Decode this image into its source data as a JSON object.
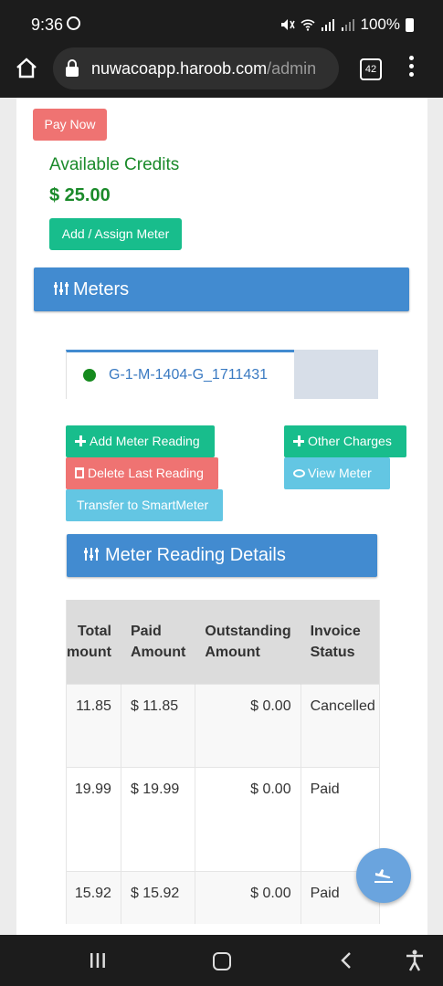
{
  "status_bar": {
    "time": "9:36",
    "battery": "100%"
  },
  "browser": {
    "url_host": "nuwacoapp.haroob.com",
    "url_path": "/admin",
    "tab_count": "42"
  },
  "account": {
    "pay_now_label": "Pay Now",
    "credits_label": "Available Credits",
    "credits_value": "$ 25.00",
    "assign_meter_label": "Add / Assign Meter"
  },
  "meters": {
    "heading": "Meters",
    "tabs": [
      {
        "name": "G-1-M-1404-G_1711431",
        "status_color": "#158a1e"
      }
    ]
  },
  "actions": {
    "add_reading": "Add Meter Reading",
    "other_charges": "Other Charges",
    "delete_last": "Delete Last Reading",
    "view_meter": "View Meter",
    "transfer": "Transfer to SmartMeter"
  },
  "details": {
    "heading": "Meter Reading Details",
    "columns": [
      [
        "Total",
        "Amount"
      ],
      [
        "Paid",
        "Amount"
      ],
      [
        "Outstanding",
        "Amount"
      ],
      [
        "Invoice",
        "Status"
      ]
    ],
    "rows": [
      {
        "total": "11.85",
        "paid": "$ 11.85",
        "outstanding": "$ 0.00",
        "status": "Cancelled"
      },
      {
        "total": "19.99",
        "paid": "$ 19.99",
        "outstanding": "$ 0.00",
        "status": "Paid"
      },
      {
        "total": "15.92",
        "paid": "$ 15.92",
        "outstanding": "$ 0.00",
        "status": "Paid"
      }
    ]
  },
  "colors": {
    "primary": "#428bd0",
    "success": "#18bd8c",
    "danger": "#ef7372",
    "info": "#63c6e3",
    "credit_green": "#1a8a2a"
  },
  "icons": [
    "whatsapp-icon",
    "mute-icon",
    "wifi-icon",
    "signal-icon",
    "battery-icon",
    "home-icon",
    "lock-icon",
    "tabs-icon",
    "overflow-menu-icon",
    "sliders-icon",
    "plus-icon",
    "trash-icon",
    "eye-icon",
    "plane-landing-icon",
    "recents-icon",
    "nav-home-icon",
    "back-icon",
    "accessibility-icon"
  ]
}
